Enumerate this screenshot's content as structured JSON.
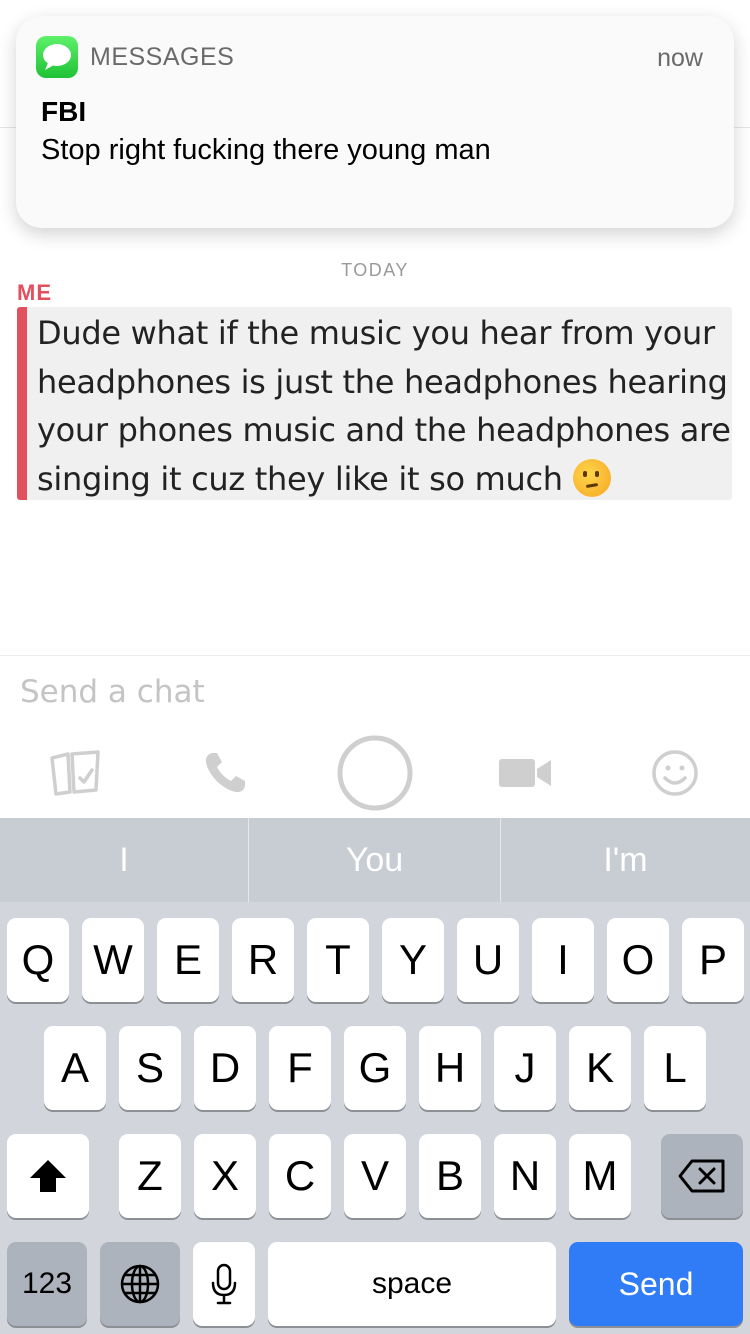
{
  "notification": {
    "app_name": "MESSAGES",
    "time": "now",
    "sender": "FBI",
    "body": "Stop right fucking there young man"
  },
  "chat": {
    "date_label": "TODAY",
    "sender_label": "ME",
    "message_text": "Dude what if the music you hear from your headphones is just the headphones hearing your phones music and the headphones are singing it cuz they like it so much ",
    "input_placeholder": "Send a chat"
  },
  "action_bar": {
    "icons": [
      "memories-card-icon",
      "phone-icon",
      "capture-circle-icon",
      "video-camera-icon",
      "smiley-icon"
    ]
  },
  "keyboard": {
    "suggestions": [
      "I",
      "You",
      "I'm"
    ],
    "row1": [
      "Q",
      "W",
      "E",
      "R",
      "T",
      "Y",
      "U",
      "I",
      "O",
      "P"
    ],
    "row2": [
      "A",
      "S",
      "D",
      "F",
      "G",
      "H",
      "J",
      "K",
      "L"
    ],
    "row3": [
      "Z",
      "X",
      "C",
      "V",
      "B",
      "N",
      "M"
    ],
    "numbers_label": "123",
    "space_label": "space",
    "send_label": "Send"
  },
  "colors": {
    "accent_me": "#e2505e",
    "send_key": "#2f7cf6",
    "keyboard_bg": "#d2d5db"
  }
}
